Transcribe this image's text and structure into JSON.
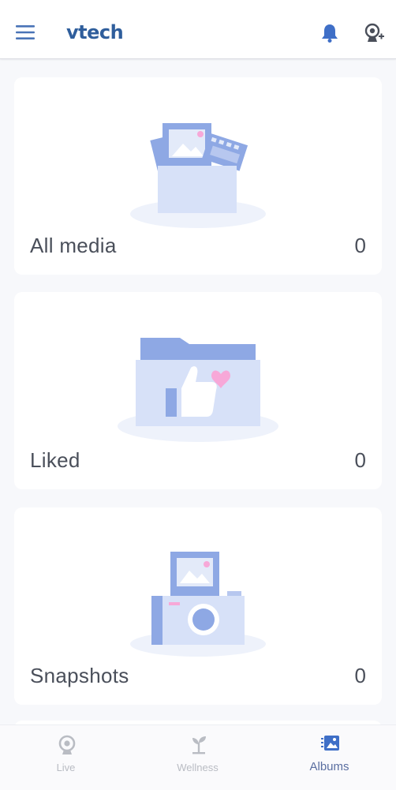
{
  "header": {
    "logo": "vtech",
    "menu_icon": "hamburger-menu-icon",
    "bell_icon": "bell-icon",
    "camera_add_icon": "camera-add-icon"
  },
  "albums": [
    {
      "title": "All media",
      "count": "0",
      "illustration": "photo-box-icon"
    },
    {
      "title": "Liked",
      "count": "0",
      "illustration": "liked-folder-icon"
    },
    {
      "title": "Snapshots",
      "count": "0",
      "illustration": "camera-photo-icon"
    }
  ],
  "bottom_nav": {
    "items": [
      {
        "label": "Live",
        "icon": "live-camera-icon",
        "active": false
      },
      {
        "label": "Wellness",
        "icon": "wellness-sprout-icon",
        "active": false
      },
      {
        "label": "Albums",
        "icon": "albums-icon",
        "active": true
      }
    ]
  },
  "colors": {
    "accent": "#2f5e9c",
    "illustration_dark": "#8ea8e4",
    "illustration_light": "#d7e1f8",
    "heart_pink": "#f7a8d8",
    "text": "#4a4f5a",
    "nav_inactive": "#b9bcc3"
  }
}
